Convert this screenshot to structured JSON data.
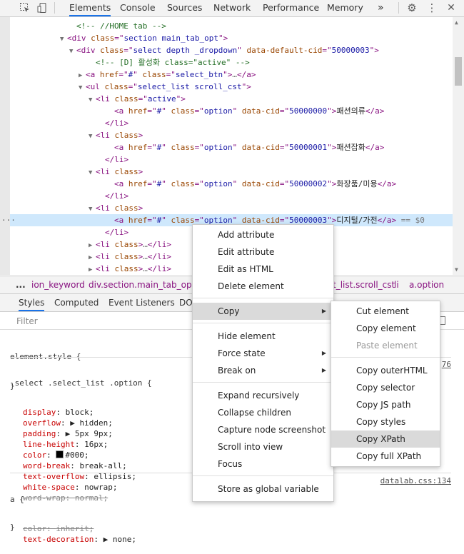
{
  "tabs": [
    "Elements",
    "Console",
    "Sources",
    "Network",
    "Performance",
    "Memory"
  ],
  "tab_overflow": "»",
  "dom_lines": [
    {
      "indent": 7,
      "tri": "",
      "parts": [
        [
          "cmt",
          "<!-- //HOME tab -->"
        ]
      ]
    },
    {
      "indent": 6,
      "tri": "▼",
      "parts": [
        [
          "tag",
          "<div "
        ],
        [
          "attr",
          "class"
        ],
        [
          "tag",
          "=\""
        ],
        [
          "val",
          "section main_tab_opt"
        ],
        [
          "tag",
          "\">"
        ]
      ]
    },
    {
      "indent": 7,
      "tri": "▼",
      "parts": [
        [
          "tag",
          "<div "
        ],
        [
          "attr",
          "class"
        ],
        [
          "tag",
          "=\""
        ],
        [
          "val",
          "select depth _dropdown"
        ],
        [
          "tag",
          "\" "
        ],
        [
          "attr",
          "data-default-cid"
        ],
        [
          "tag",
          "=\""
        ],
        [
          "val",
          "50000003"
        ],
        [
          "tag",
          "\">"
        ]
      ]
    },
    {
      "indent": 9,
      "tri": "",
      "parts": [
        [
          "cmt",
          "<!-- [D] 활성화 class=\"active\" -->"
        ]
      ]
    },
    {
      "indent": 8,
      "tri": "▶",
      "parts": [
        [
          "tag",
          "<a "
        ],
        [
          "attr",
          "href"
        ],
        [
          "tag",
          "=\""
        ],
        [
          "val",
          "#"
        ],
        [
          "tag",
          "\" "
        ],
        [
          "attr",
          "class"
        ],
        [
          "tag",
          "=\""
        ],
        [
          "val",
          "select_btn"
        ],
        [
          "tag",
          "\">"
        ],
        [
          "dim",
          "…"
        ],
        [
          "tag",
          "</a>"
        ]
      ]
    },
    {
      "indent": 8,
      "tri": "▼",
      "parts": [
        [
          "tag",
          "<ul "
        ],
        [
          "attr",
          "class"
        ],
        [
          "tag",
          "=\""
        ],
        [
          "val",
          "select_list scroll_cst"
        ],
        [
          "tag",
          "\">"
        ]
      ]
    },
    {
      "indent": 9,
      "tri": "▼",
      "parts": [
        [
          "tag",
          "<li "
        ],
        [
          "attr",
          "class"
        ],
        [
          "tag",
          "=\""
        ],
        [
          "val",
          "active"
        ],
        [
          "tag",
          "\">"
        ]
      ]
    },
    {
      "indent": 11,
      "tri": "",
      "parts": [
        [
          "tag",
          "<a "
        ],
        [
          "attr",
          "href"
        ],
        [
          "tag",
          "=\""
        ],
        [
          "val",
          "#"
        ],
        [
          "tag",
          "\" "
        ],
        [
          "attr",
          "class"
        ],
        [
          "tag",
          "=\""
        ],
        [
          "val",
          "option"
        ],
        [
          "tag",
          "\" "
        ],
        [
          "attr",
          "data-cid"
        ],
        [
          "tag",
          "=\""
        ],
        [
          "val",
          "50000000"
        ],
        [
          "tag",
          "\">"
        ],
        [
          "txt",
          "패션의류"
        ],
        [
          "tag",
          "</a>"
        ]
      ]
    },
    {
      "indent": 10,
      "tri": "",
      "parts": [
        [
          "tag",
          "</li>"
        ]
      ]
    },
    {
      "indent": 9,
      "tri": "▼",
      "parts": [
        [
          "tag",
          "<li "
        ],
        [
          "attr",
          "class"
        ],
        [
          "tag",
          ">"
        ]
      ]
    },
    {
      "indent": 11,
      "tri": "",
      "parts": [
        [
          "tag",
          "<a "
        ],
        [
          "attr",
          "href"
        ],
        [
          "tag",
          "=\""
        ],
        [
          "val",
          "#"
        ],
        [
          "tag",
          "\" "
        ],
        [
          "attr",
          "class"
        ],
        [
          "tag",
          "=\""
        ],
        [
          "val",
          "option"
        ],
        [
          "tag",
          "\" "
        ],
        [
          "attr",
          "data-cid"
        ],
        [
          "tag",
          "=\""
        ],
        [
          "val",
          "50000001"
        ],
        [
          "tag",
          "\">"
        ],
        [
          "txt",
          "패션잡화"
        ],
        [
          "tag",
          "</a>"
        ]
      ]
    },
    {
      "indent": 10,
      "tri": "",
      "parts": [
        [
          "tag",
          "</li>"
        ]
      ]
    },
    {
      "indent": 9,
      "tri": "▼",
      "parts": [
        [
          "tag",
          "<li "
        ],
        [
          "attr",
          "class"
        ],
        [
          "tag",
          ">"
        ]
      ]
    },
    {
      "indent": 11,
      "tri": "",
      "parts": [
        [
          "tag",
          "<a "
        ],
        [
          "attr",
          "href"
        ],
        [
          "tag",
          "=\""
        ],
        [
          "val",
          "#"
        ],
        [
          "tag",
          "\" "
        ],
        [
          "attr",
          "class"
        ],
        [
          "tag",
          "=\""
        ],
        [
          "val",
          "option"
        ],
        [
          "tag",
          "\" "
        ],
        [
          "attr",
          "data-cid"
        ],
        [
          "tag",
          "=\""
        ],
        [
          "val",
          "50000002"
        ],
        [
          "tag",
          "\">"
        ],
        [
          "txt",
          "화장품/미용"
        ],
        [
          "tag",
          "</a>"
        ]
      ]
    },
    {
      "indent": 10,
      "tri": "",
      "parts": [
        [
          "tag",
          "</li>"
        ]
      ]
    },
    {
      "indent": 9,
      "tri": "▼",
      "parts": [
        [
          "tag",
          "<li "
        ],
        [
          "attr",
          "class"
        ],
        [
          "tag",
          ">"
        ]
      ]
    },
    {
      "indent": 11,
      "tri": "",
      "selected": true,
      "parts": [
        [
          "tag",
          "<a "
        ],
        [
          "attr",
          "href"
        ],
        [
          "tag",
          "=\""
        ],
        [
          "val",
          "#"
        ],
        [
          "tag",
          "\" "
        ],
        [
          "attr",
          "class"
        ],
        [
          "tag",
          "=\""
        ],
        [
          "val",
          "option"
        ],
        [
          "tag",
          "\" "
        ],
        [
          "attr",
          "data-cid"
        ],
        [
          "tag",
          "=\""
        ],
        [
          "val",
          "50000003"
        ],
        [
          "tag",
          "\">"
        ],
        [
          "txt",
          "디지털/가전"
        ],
        [
          "tag",
          "</a>"
        ],
        [
          "eq0",
          " == $0"
        ]
      ]
    },
    {
      "indent": 10,
      "tri": "",
      "parts": [
        [
          "tag",
          "</li>"
        ]
      ]
    },
    {
      "indent": 9,
      "tri": "▶",
      "parts": [
        [
          "tag",
          "<li "
        ],
        [
          "attr",
          "class"
        ],
        [
          "tag",
          ">"
        ],
        [
          "dim",
          "…"
        ],
        [
          "tag",
          "</li>"
        ]
      ]
    },
    {
      "indent": 9,
      "tri": "▶",
      "parts": [
        [
          "tag",
          "<li "
        ],
        [
          "attr",
          "class"
        ],
        [
          "tag",
          ">"
        ],
        [
          "dim",
          "…"
        ],
        [
          "tag",
          "</li>"
        ]
      ]
    },
    {
      "indent": 9,
      "tri": "▶",
      "parts": [
        [
          "tag",
          "<li "
        ],
        [
          "attr",
          "class"
        ],
        [
          "tag",
          ">"
        ],
        [
          "dim",
          "…"
        ],
        [
          "tag",
          "</li>"
        ]
      ]
    }
  ],
  "selected_dots": "···",
  "breadcrumbs": [
    "...",
    "ion_keyword",
    "div.section.main_tab_opt",
    "t_list.scroll_cst",
    "li",
    "a.option"
  ],
  "subtabs": [
    "Styles",
    "Computed",
    "Event Listeners",
    "DO"
  ],
  "filter_placeholder": "Filter",
  "element_style": [
    "element.style {",
    "}"
  ],
  "rule1": {
    "selector": ".select .select_list .option {",
    "source": "76",
    "props": [
      {
        "name": "display",
        "value": "block;",
        "strike": false
      },
      {
        "name": "overflow",
        "value": "▶ hidden;",
        "strike": false
      },
      {
        "name": "padding",
        "value": "▶ 5px 9px;",
        "strike": false
      },
      {
        "name": "line-height",
        "value": "16px;",
        "strike": false
      },
      {
        "name": "color",
        "value": "#000;",
        "strike": false,
        "swatch": "#000000"
      },
      {
        "name": "word-break",
        "value": "break-all;",
        "strike": false
      },
      {
        "name": "text-overflow",
        "value": "ellipsis;",
        "strike": false
      },
      {
        "name": "white-space",
        "value": "nowrap;",
        "strike": false
      },
      {
        "name": "word-wrap",
        "value": "normal;",
        "strike": true
      }
    ],
    "close": "}"
  },
  "rule2": {
    "selector": "a {",
    "source": "datalab.css:134",
    "props": [
      {
        "name": "color",
        "value": "inherit;",
        "strike": true
      },
      {
        "name": "text-decoration",
        "value": "▶ none;",
        "strike": false
      }
    ]
  },
  "context_menu": {
    "items": [
      "Add attribute",
      "Edit attribute",
      "Edit as HTML",
      "Delete element",
      "Copy",
      "Hide element",
      "Force state",
      "Break on",
      "Expand recursively",
      "Collapse children",
      "Capture node screenshot",
      "Scroll into view",
      "Focus",
      "Store as global variable"
    ]
  },
  "copy_menu": {
    "items": [
      "Cut element",
      "Copy element",
      "Paste element",
      "Copy outerHTML",
      "Copy selector",
      "Copy JS path",
      "Copy styles",
      "Copy XPath",
      "Copy full XPath"
    ]
  },
  "colors": {
    "accent": "#1a73e8",
    "tag": "#881280",
    "attr": "#994500",
    "value": "#1a1aa6",
    "comment": "#236e25"
  }
}
